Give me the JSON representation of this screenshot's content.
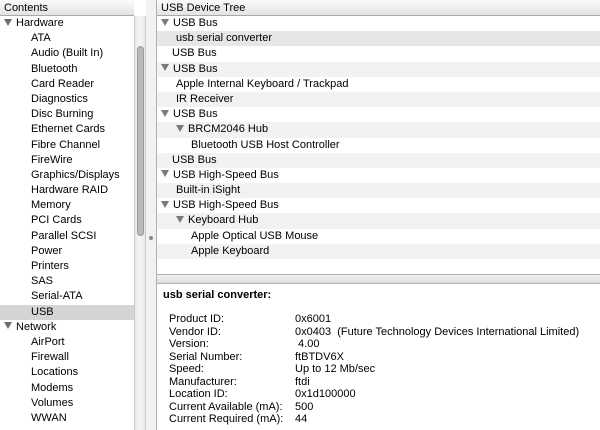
{
  "sidebar": {
    "header": "Contents",
    "groups": [
      {
        "label": "Hardware",
        "items": [
          "ATA",
          "Audio (Built In)",
          "Bluetooth",
          "Card Reader",
          "Diagnostics",
          "Disc Burning",
          "Ethernet Cards",
          "Fibre Channel",
          "FireWire",
          "Graphics/Displays",
          "Hardware RAID",
          "Memory",
          "PCI Cards",
          "Parallel SCSI",
          "Power",
          "Printers",
          "SAS",
          "Serial-ATA",
          "USB"
        ]
      },
      {
        "label": "Network",
        "items": [
          "AirPort",
          "Firewall",
          "Locations",
          "Modems",
          "Volumes",
          "WWAN"
        ]
      }
    ],
    "selected": "USB"
  },
  "tree": {
    "header": "USB Device Tree",
    "rows": [
      {
        "label": "USB Bus",
        "indent": 0,
        "expanded": true
      },
      {
        "label": "usb serial converter",
        "indent": 1,
        "selected": true
      },
      {
        "label": "USB Bus",
        "indent": 0
      },
      {
        "label": "USB Bus",
        "indent": 0,
        "expanded": true
      },
      {
        "label": "Apple Internal Keyboard / Trackpad",
        "indent": 1
      },
      {
        "label": "IR Receiver",
        "indent": 1
      },
      {
        "label": "USB Bus",
        "indent": 0,
        "expanded": true
      },
      {
        "label": "BRCM2046 Hub",
        "indent": 1,
        "expanded": true
      },
      {
        "label": "Bluetooth USB Host Controller",
        "indent": 2
      },
      {
        "label": "USB Bus",
        "indent": 0
      },
      {
        "label": "USB High-Speed Bus",
        "indent": 0,
        "expanded": true
      },
      {
        "label": "Built-in iSight",
        "indent": 1
      },
      {
        "label": "USB High-Speed Bus",
        "indent": 0,
        "expanded": true
      },
      {
        "label": "Keyboard Hub",
        "indent": 1,
        "expanded": true
      },
      {
        "label": "Apple Optical USB Mouse",
        "indent": 2
      },
      {
        "label": "Apple Keyboard",
        "indent": 2
      }
    ]
  },
  "details": {
    "title": "usb serial converter:",
    "fields": [
      {
        "label": "Product ID:",
        "value": "0x6001"
      },
      {
        "label": "Vendor ID:",
        "value": "0x0403  (Future Technology Devices International Limited)"
      },
      {
        "label": "Version:",
        "value": " 4.00"
      },
      {
        "label": "Serial Number:",
        "value": "ftBTDV6X"
      },
      {
        "label": "Speed:",
        "value": "Up to 12 Mb/sec"
      },
      {
        "label": "Manufacturer:",
        "value": "ftdi"
      },
      {
        "label": "Location ID:",
        "value": "0x1d100000"
      },
      {
        "label": "Current Available (mA):",
        "value": "500"
      },
      {
        "label": "Current Required (mA):",
        "value": "44"
      }
    ]
  }
}
